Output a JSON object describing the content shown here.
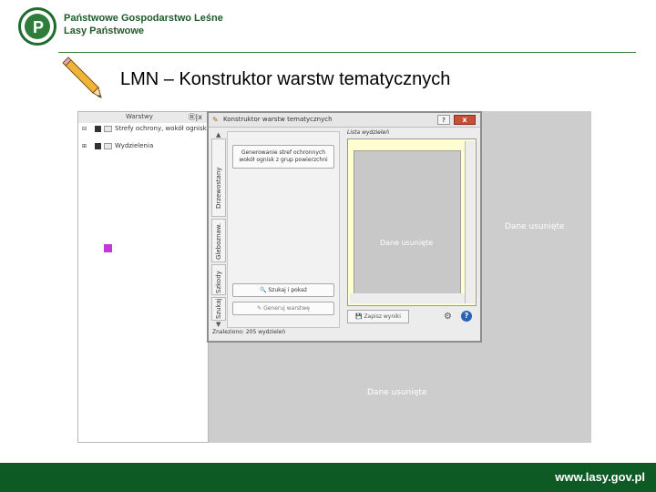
{
  "header": {
    "org_line1": "Państwowe Gospodarstwo Leśne",
    "org_line2": "Lasy Państwowe",
    "logo_text": "P",
    "logo_icon": "lasy-panstwowe-logo",
    "brand_green": "#1f5b2a"
  },
  "slide": {
    "title": "LMN – Konstruktor warstw tematycznych",
    "pencil_icon": "pencil-icon"
  },
  "layers_panel": {
    "title": "Warstwy",
    "controls": "Ⓡ|x",
    "items": [
      {
        "label": "Strefy ochrony, wokół ognisk"
      },
      {
        "label": "Wydzielenia"
      }
    ],
    "swatch_color": "#c23ad6"
  },
  "dialog": {
    "title": "Konstruktor warstw tematycznych",
    "help": "?",
    "close": "x",
    "tabs": [
      "Szukaj",
      "Szkody",
      "Gleboznaw.",
      "Drzewostany"
    ],
    "gen_button": "Generowanie stref ochronnych wokół ognisk z grup powierzchni",
    "show_button": "Szukaj i pokaż",
    "layer_button": "Generuj warstwę",
    "list_label": "Lista wydzieleń",
    "list_placeholder": "Dane usunięte",
    "save_button": "Zapisz wyniki",
    "status": "Znaleziono: 205 wydzieleń"
  },
  "canvas": {
    "placeholder_right": "Dane usunięte",
    "placeholder_bottom": "Dane usunięte"
  },
  "footer": {
    "url": "www.lasy.gov.pl",
    "color": "#0e5a25"
  }
}
